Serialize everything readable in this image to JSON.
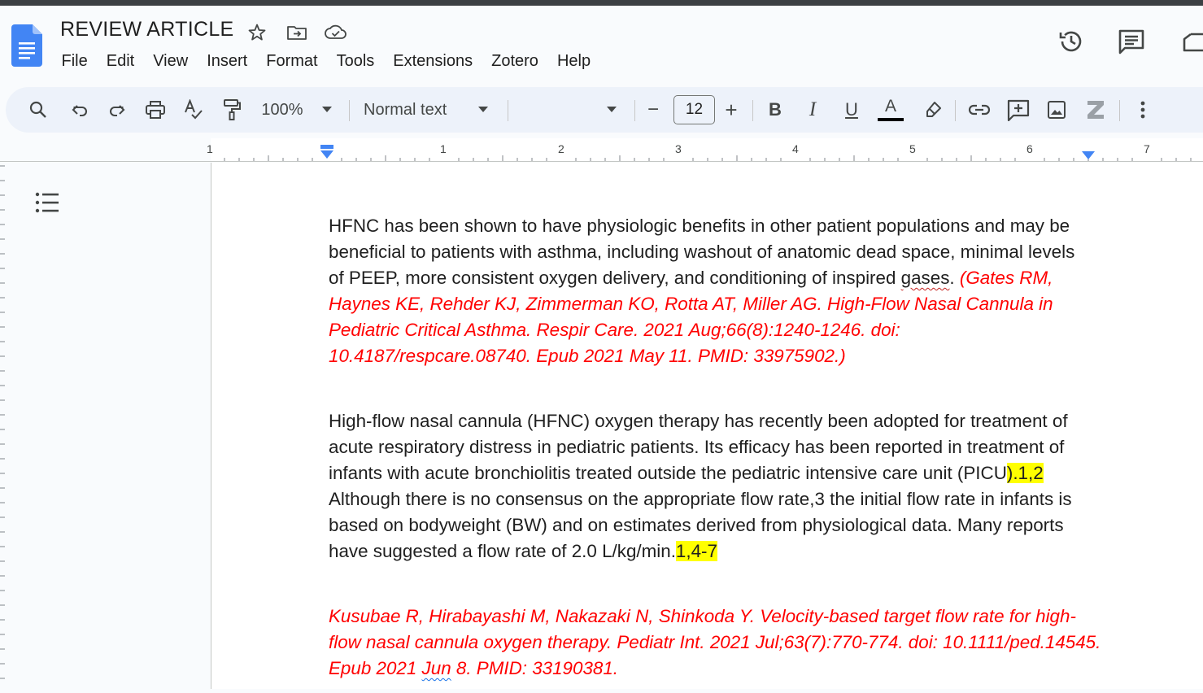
{
  "document": {
    "title": "REVIEW ARTICLE"
  },
  "menu": [
    "File",
    "Edit",
    "View",
    "Insert",
    "Format",
    "Tools",
    "Extensions",
    "Zotero",
    "Help"
  ],
  "toolbar": {
    "zoom": "100%",
    "style": "Normal text",
    "font": "",
    "font_size": "12",
    "decrement": "−",
    "increment": "+",
    "bold": "B",
    "italic": "I",
    "underline": "U",
    "text_color": "A"
  },
  "ruler": {
    "numbers": [
      "1",
      "1",
      "2",
      "3",
      "4",
      "5",
      "6",
      "7"
    ]
  },
  "colors": {
    "citation": "#ff0000",
    "highlight": "#ffff00",
    "docs_blue": "#4285f4"
  },
  "icons": {
    "header": [
      "star-icon",
      "move-to-folder-icon",
      "cloud-saved-icon",
      "version-history-icon",
      "comments-icon",
      "share-icon"
    ],
    "toolbar": [
      "search-icon",
      "undo-icon",
      "redo-icon",
      "print-icon",
      "spellcheck-icon",
      "paint-format-icon",
      "link-icon",
      "add-comment-icon",
      "insert-image-icon",
      "zotero-icon",
      "more-icon"
    ],
    "outline": "outline-icon"
  },
  "body": {
    "p1": {
      "text_a": "HFNC has been shown to have physiologic benefits in other patient populations and may be beneficial to patients with asthma, including washout of anatomic dead space, minimal levels of PEEP, more consistent oxygen delivery, and conditioning of inspired ",
      "misspelled": "gases",
      "text_b": ". ",
      "citation": "(Gates RM, Haynes KE, Rehder KJ, Zimmerman KO, Rotta AT, Miller AG. High-Flow Nasal Cannula in Pediatric Critical Asthma. Respir Care. 2021 Aug;66(8):1240-1246. doi: 10.4187/respcare.08740. Epub 2021 May 11. PMID: 33975902.)"
    },
    "p2": {
      "text_a": "High-flow nasal cannula (HFNC) oxygen therapy has recently been adopted for treatment of acute respiratory distress in pediatric patients. Its efficacy has been reported in treatment of infants with acute bronchiolitis treated outside the pediatric intensive care unit (PICU",
      "hl_1": ").1,2",
      "text_b": " Although there is no consensus on the appropriate flow rate,3 the initial flow rate in infants is based on bodyweight (BW) and on estimates derived from physiological data. Many reports have suggested a flow rate of 2.0 L/kg/min.",
      "hl_2": "1,4-7"
    },
    "p3": {
      "citation_a": "Kusubae R, Hirabayashi M, Nakazaki N, Shinkoda Y. Velocity-based target flow rate for high-flow nasal cannula oxygen therapy. Pediatr Int. 2021 Jul;63(7):770-774. doi: 10.1111/ped.14545. Epub 2021 ",
      "citation_flag": "Jun",
      "citation_b": " 8. PMID: 33190381."
    }
  }
}
